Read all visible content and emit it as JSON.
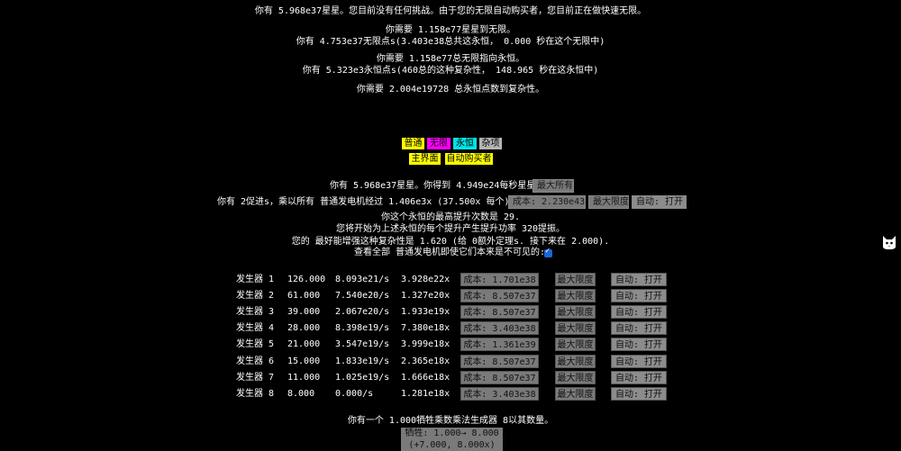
{
  "header": {
    "line1": "你有 5.968e37星星。您目前没有任何挑战。由于您的无限自动购买者，您目前正在做快速无限。",
    "line2": "你需要 1.158e77星星到无限。",
    "line3": "你有 4.753e37无限点s(3.403e38总共这永恒， 0.000 秒在这个无限中)",
    "line4": "你需要 1.158e77总无限指向永恒。",
    "line5": "你有 5.323e3永恒点s(460总的这种复杂性， 148.965 秒在这永恒中)",
    "line6": "你需要 2.004e19728 总永恒点数到复杂性。"
  },
  "tabs": {
    "row1": [
      {
        "label": "普通",
        "color": "#ffff00"
      },
      {
        "label": "无限",
        "color": "#ff00ff"
      },
      {
        "label": "永恒",
        "color": "#00e5e5"
      },
      {
        "label": "杂项",
        "color": "#b5b5b5"
      }
    ],
    "row2": [
      {
        "label": "主界面",
        "color": "#ffff00"
      },
      {
        "label": "自动购买者",
        "color": "#ffff00"
      }
    ]
  },
  "stars": {
    "text": "你有 5.968e37星星。你得到 4.949e24每秒星星。",
    "max_all": "最大所有"
  },
  "boost": {
    "text": "你有 2促进s，乘以所有 普通发电机经过 1.406e3x (37.500x 每个)。",
    "cost": "成本: 2.230e43",
    "max": "最大限度",
    "auto": "自动: 打开"
  },
  "info": {
    "l1": "你这个永恒的最高提升次数是 29.",
    "l2": "您将开始为上述永恒的每个提升产生提升功率 320提振。",
    "l3": "您的 最好能增强这种复杂性是 1.620 (给 0额外定理s. 接下来在 2.000).",
    "l4": "查看全部 普通发电机即使它们本来是不可见的:"
  },
  "generators": [
    {
      "name": "发生器 1",
      "amount": "126.000",
      "rate": "8.093e21/s",
      "mult": "3.928e22x",
      "cost": "成本: 1.701e38",
      "max": "最大限度",
      "auto": "自动: 打开"
    },
    {
      "name": "发生器 2",
      "amount": "61.000",
      "rate": "7.540e20/s",
      "mult": "1.327e20x",
      "cost": "成本: 8.507e37",
      "max": "最大限度",
      "auto": "自动: 打开"
    },
    {
      "name": "发生器 3",
      "amount": "39.000",
      "rate": "2.067e20/s",
      "mult": "1.933e19x",
      "cost": "成本: 8.507e37",
      "max": "最大限度",
      "auto": "自动: 打开"
    },
    {
      "name": "发生器 4",
      "amount": "28.000",
      "rate": "8.398e19/s",
      "mult": "7.380e18x",
      "cost": "成本: 3.403e38",
      "max": "最大限度",
      "auto": "自动: 打开"
    },
    {
      "name": "发生器 5",
      "amount": "21.000",
      "rate": "3.547e19/s",
      "mult": "3.999e18x",
      "cost": "成本: 1.361e39",
      "max": "最大限度",
      "auto": "自动: 打开"
    },
    {
      "name": "发生器 6",
      "amount": "15.000",
      "rate": "1.833e19/s",
      "mult": "2.365e18x",
      "cost": "成本: 8.507e37",
      "max": "最大限度",
      "auto": "自动: 打开"
    },
    {
      "name": "发生器 7",
      "amount": "11.000",
      "rate": "1.025e19/s",
      "mult": "1.666e18x",
      "cost": "成本: 8.507e37",
      "max": "最大限度",
      "auto": "自动: 打开"
    },
    {
      "name": "发生器 8",
      "amount": "8.000",
      "rate": "0.000/s",
      "mult": "1.281e18x",
      "cost": "成本: 3.403e38",
      "max": "最大限度",
      "auto": "自动: 打开"
    }
  ],
  "sacrifice": {
    "text": "你有一个 1.000牺牲乘数乘法生成器 8以其数量。",
    "button_line1": "牺牲: 1.000→ 8.000",
    "button_line2": "(+7.000, 8.000x)"
  },
  "icons": {
    "cat": "cat-icon"
  }
}
